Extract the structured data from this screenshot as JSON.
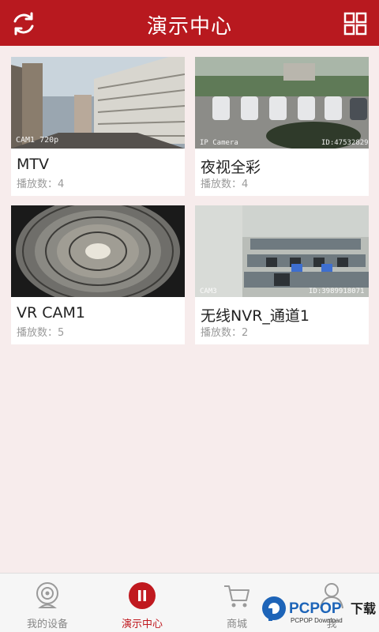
{
  "header": {
    "title": "演示中心"
  },
  "cards": [
    {
      "name": "MTV",
      "plays_label": "播放数：",
      "plays": "4",
      "overlay": "CAM1 720p"
    },
    {
      "name": "夜视全彩",
      "plays_label": "播放数：",
      "plays": "4",
      "overlay_left": "IP Camera",
      "overlay_right": "ID:475328293"
    },
    {
      "name": "VR CAM1",
      "plays_label": "播放数：",
      "plays": "5"
    },
    {
      "name": "无线NVR_通道1",
      "plays_label": "播放数：",
      "plays": "2",
      "overlay_left": "CAM3",
      "overlay_right": "ID:3989918071"
    }
  ],
  "nav": [
    {
      "label": "我的设备",
      "icon": "camera-icon",
      "active": false
    },
    {
      "label": "演示中心",
      "icon": "pause-icon",
      "active": true
    },
    {
      "label": "商城",
      "icon": "cart-icon",
      "active": false
    },
    {
      "label": "我",
      "icon": "person-icon",
      "active": false
    }
  ],
  "watermark": {
    "brand": "PCPOP",
    "suffix": "下载",
    "sub": "PCPOP Download"
  },
  "colors": {
    "brand_red": "#b8191f",
    "background": "#f7ecec"
  }
}
